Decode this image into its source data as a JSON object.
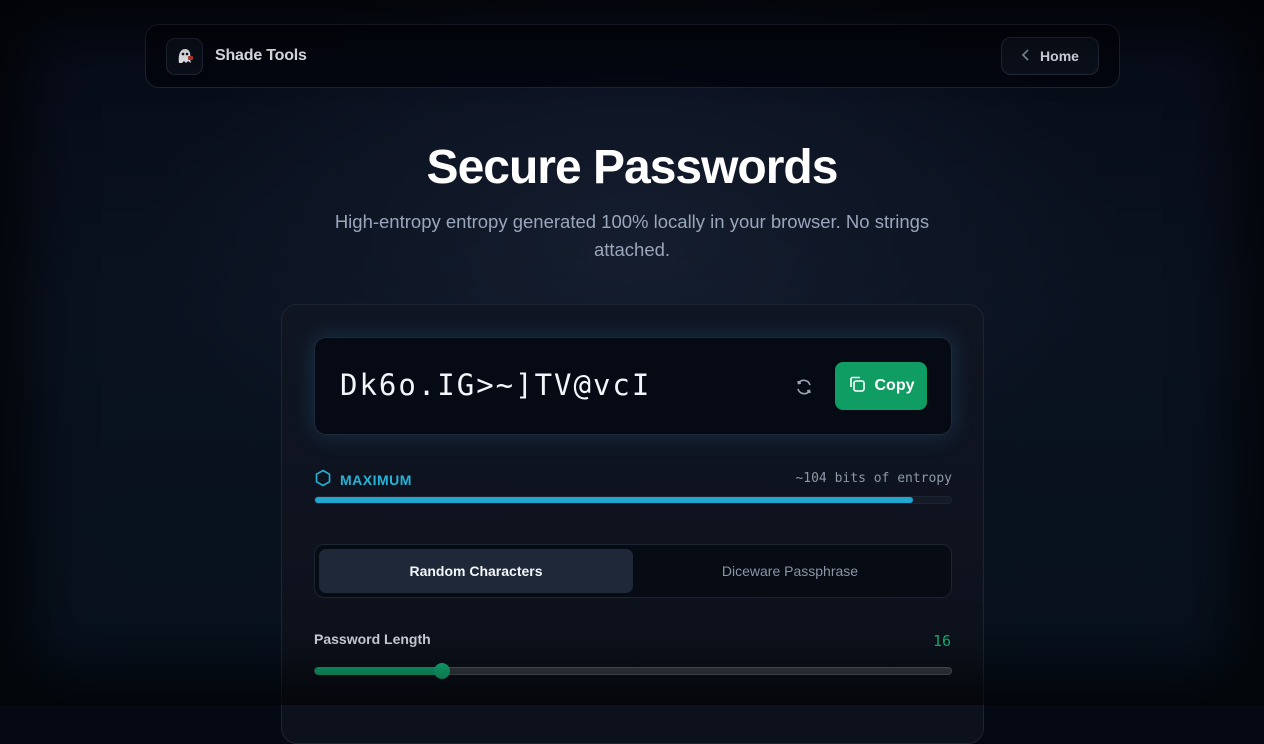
{
  "brand": {
    "name": "Shade Tools",
    "logo_icon": "ghost-logo-icon"
  },
  "nav": {
    "home_label": "Home",
    "back_icon": "chevron-left-icon"
  },
  "hero": {
    "title": "Secure Passwords",
    "subtitle": "High-entropy entropy generated 100% locally in your browser. No strings attached."
  },
  "generator": {
    "password": "Dk6o.IG>~]TV@vcI",
    "copy_label": "Copy",
    "copy_icon": "copy-icon",
    "refresh_icon": "refresh-icon",
    "strength_label": "MAXIMUM",
    "strength_icon": "hexagon-icon",
    "entropy_text": "~104 bits of entropy",
    "strength_fraction": 0.94,
    "colors": {
      "accent": "#22a6cf",
      "copy": "#0f9d63",
      "slider": "#13b27b"
    }
  },
  "tabs": [
    {
      "label": "Random Characters",
      "active": true
    },
    {
      "label": "Diceware Passphrase",
      "active": false
    }
  ],
  "length": {
    "label": "Password Length",
    "value": "16",
    "min": 4,
    "max": 64,
    "current": 16
  }
}
